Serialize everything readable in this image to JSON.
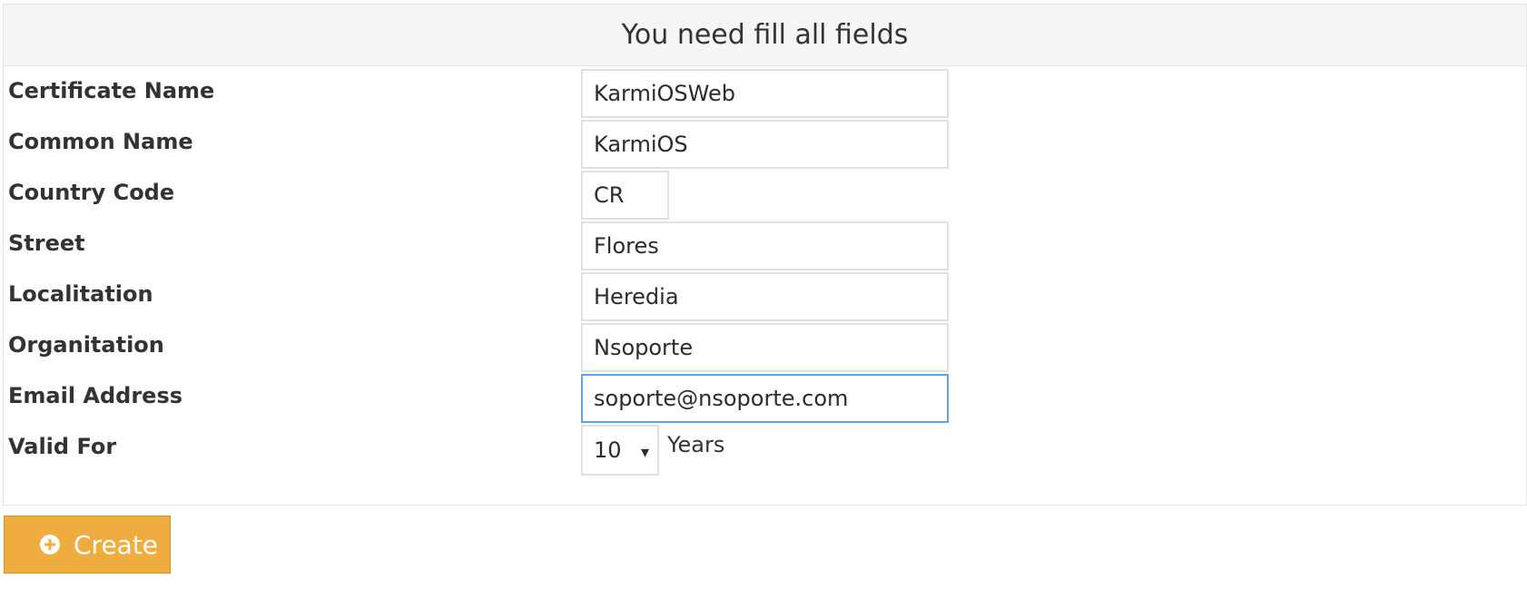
{
  "header": {
    "title": "You need fill all fields"
  },
  "form": {
    "fields": [
      {
        "label": "Certificate Name",
        "value": "KarmiOSWeb"
      },
      {
        "label": "Common Name",
        "value": "KarmiOS"
      },
      {
        "label": "Country Code",
        "value": "CR"
      },
      {
        "label": "Street",
        "value": "Flores"
      },
      {
        "label": "Localitation",
        "value": "Heredia"
      },
      {
        "label": "Organitation",
        "value": "Nsoporte"
      },
      {
        "label": "Email Address",
        "value": "soporte@nsoporte.com"
      }
    ],
    "valid_for": {
      "label": "Valid For",
      "selected": "10",
      "unit": "Years"
    }
  },
  "actions": {
    "create_label": "Create"
  },
  "colors": {
    "accent": "#f0ad3f",
    "focus": "#5aa6e0"
  },
  "icons": {
    "create": "plus-circle-icon",
    "select": "chevron-down-icon"
  }
}
